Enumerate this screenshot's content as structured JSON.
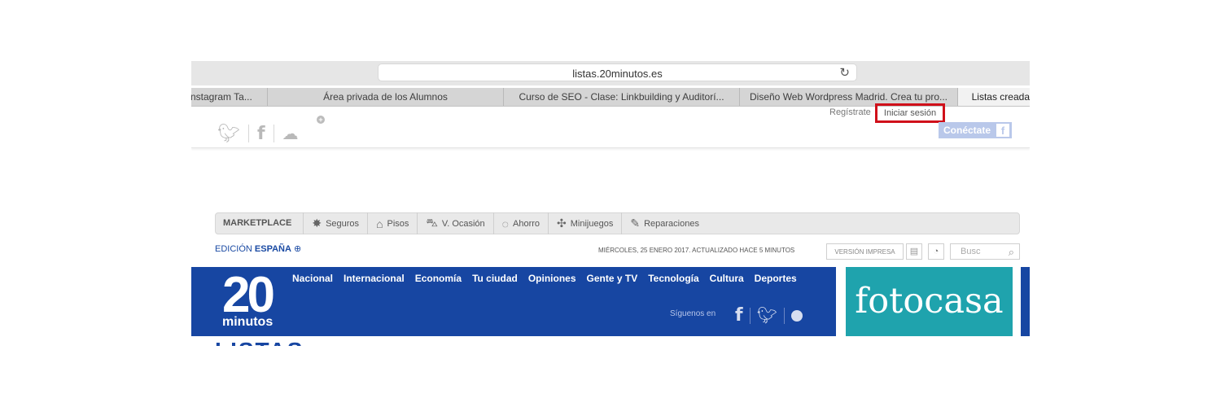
{
  "browser": {
    "url": "listas.20minutos.es",
    "reload_icon": "reload-icon",
    "tabs": [
      {
        "label": "nstagram Ta...",
        "active": false
      },
      {
        "label": "Área privada de los Alumnos",
        "active": false
      },
      {
        "label": "Curso de SEO - Clase: Linkbuilding y Auditorí...",
        "active": false
      },
      {
        "label": "Diseño Web Wordpress Madrid. Crea tu pro...",
        "active": false
      },
      {
        "label": "Listas creada",
        "active": true
      }
    ]
  },
  "account": {
    "register": "Regístrate",
    "login": "Iniciar sesión",
    "connect": "Conéctate",
    "connect_icon": "f"
  },
  "marketplace": {
    "title": "MARKETPLACE",
    "items": [
      {
        "label": "Seguros",
        "icon": "car-crash-icon"
      },
      {
        "label": "Pisos",
        "icon": "house-icon"
      },
      {
        "label": "V. Ocasión",
        "icon": "car-icon"
      },
      {
        "label": "Ahorro",
        "icon": "piggy-bank-icon"
      },
      {
        "label": "Minijuegos",
        "icon": "puzzle-icon"
      },
      {
        "label": "Reparaciones",
        "icon": "wrench-icon"
      }
    ]
  },
  "edition": {
    "prefix": "EDICIÓN",
    "name": "ESPAÑA"
  },
  "date_text": "MIÉRCOLES, 25 ENERO 2017. ACTUALIZADO HACE 5 MINUTOS",
  "print_version": "VERSIÓN IMPRESA",
  "search_placeholder": "Busc",
  "logo": {
    "number": "20",
    "word": "minutos"
  },
  "nav": [
    "Nacional",
    "Internacional",
    "Economía",
    "Tu ciudad",
    "Opiniones",
    "Gente y TV",
    "Tecnología",
    "Cultura",
    "Deportes"
  ],
  "follow_text": "Síguenos en",
  "ad_text": "fotocasa",
  "section_title": "LISTAS",
  "colors": {
    "brand_blue": "#1746a2",
    "ad_teal": "#1fa3ad",
    "highlight_red": "#d0101a"
  }
}
